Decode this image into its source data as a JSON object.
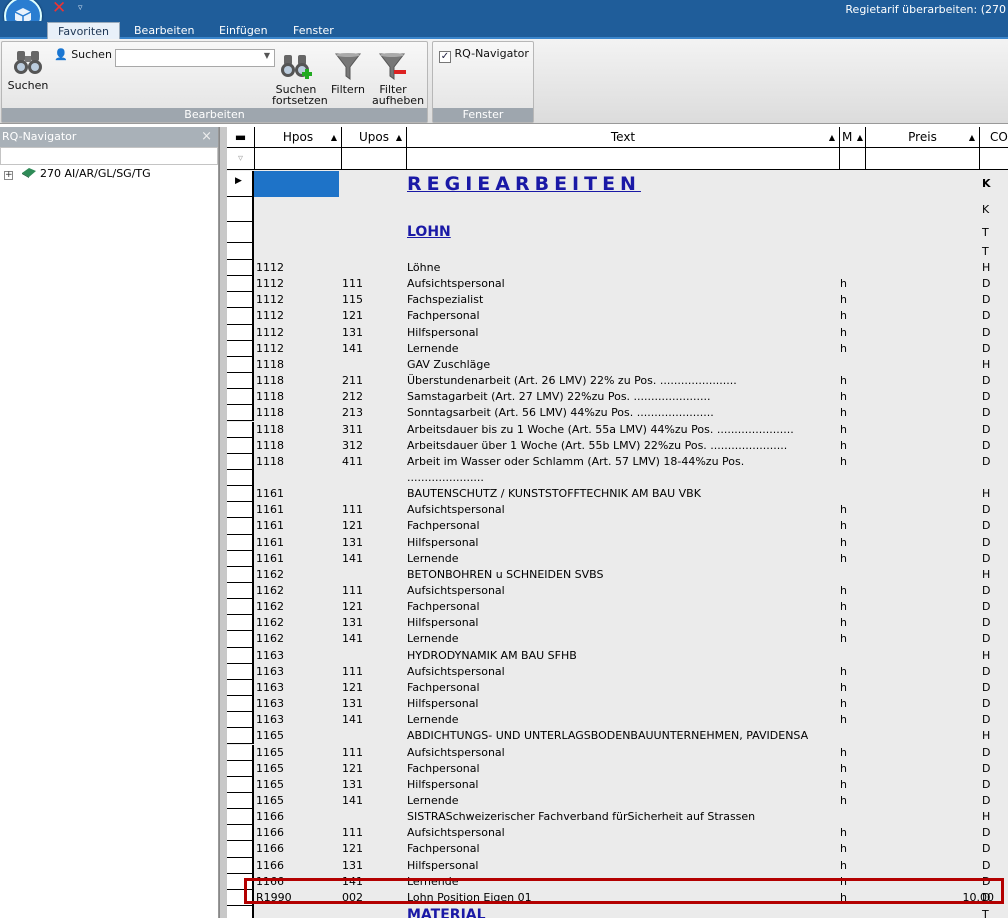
{
  "window": {
    "title": "Regietarif überarbeiten: (270"
  },
  "ribbon": {
    "tabs": [
      {
        "label": "Favoriten",
        "active": true
      },
      {
        "label": "Bearbeiten",
        "active": false
      },
      {
        "label": "Einfügen",
        "active": false
      },
      {
        "label": "Fenster",
        "active": false
      }
    ],
    "bearbeiten_group": {
      "label": "Bearbeiten",
      "suchen_small": "Suchen",
      "suchen": "Suchen",
      "suchen_fortsetzen_1": "Suchen",
      "suchen_fortsetzen_2": "fortsetzen",
      "filtern": "Filtern",
      "filter_aufheben_1": "Filter",
      "filter_aufheben_2": "aufheben"
    },
    "fenster_group": {
      "label": "Fenster",
      "rq_navigator": "RQ-Navigator",
      "rq_checked": "✓"
    }
  },
  "navigator": {
    "title": "RQ-Navigator",
    "close": "×",
    "tree": [
      {
        "expander": "+",
        "label": "270 AI/AR/GL/SG/TG"
      }
    ]
  },
  "grid": {
    "columns": {
      "hpos": "Hpos",
      "upos": "Upos",
      "text": "Text",
      "me": "M",
      "preis": "Preis",
      "co": "CO",
      "sort_up": "▲"
    },
    "filter_icon": "▿",
    "row_indicator": "▶",
    "rows": [
      {
        "hpos": "",
        "upos": "",
        "text": "REGIEARBEITEN",
        "me": "",
        "preis": "",
        "co": "K"
      },
      {
        "hpos": "",
        "upos": "",
        "text": "",
        "me": "",
        "preis": "",
        "co": "K"
      },
      {
        "hpos": "",
        "upos": "",
        "text": "LOHN",
        "me": "",
        "preis": "",
        "co": "T"
      },
      {
        "hpos": "",
        "upos": "",
        "text": "",
        "me": "",
        "preis": "",
        "co": "T"
      },
      {
        "hpos": "1112",
        "upos": "",
        "text": "Löhne",
        "me": "",
        "preis": "",
        "co": "H"
      },
      {
        "hpos": "1112",
        "upos": "111",
        "text": "Aufsichtspersonal",
        "me": "h",
        "preis": "",
        "co": "D"
      },
      {
        "hpos": "1112",
        "upos": "115",
        "text": "Fachspezialist",
        "me": "h",
        "preis": "",
        "co": "D"
      },
      {
        "hpos": "1112",
        "upos": "121",
        "text": "Fachpersonal",
        "me": "h",
        "preis": "",
        "co": "D"
      },
      {
        "hpos": "1112",
        "upos": "131",
        "text": "Hilfspersonal",
        "me": "h",
        "preis": "",
        "co": "D"
      },
      {
        "hpos": "1112",
        "upos": "141",
        "text": "Lernende",
        "me": "h",
        "preis": "",
        "co": "D"
      },
      {
        "hpos": "1118",
        "upos": "",
        "text": "GAV Zuschläge",
        "me": "",
        "preis": "",
        "co": "H"
      },
      {
        "hpos": "1118",
        "upos": "211",
        "text": "Überstundenarbeit (Art. 26 LMV)   22% zu Pos. ......................",
        "me": "h",
        "preis": "",
        "co": "D"
      },
      {
        "hpos": "1118",
        "upos": "212",
        "text": "Samstagarbeit (Art. 27 LMV)          22%zu Pos. ......................",
        "me": "h",
        "preis": "",
        "co": "D"
      },
      {
        "hpos": "1118",
        "upos": "213",
        "text": "Sonntagsarbeit (Art. 56 LMV)         44%zu Pos. ......................",
        "me": "h",
        "preis": "",
        "co": "D"
      },
      {
        "hpos": "1118",
        "upos": "311",
        "text": "Arbeitsdauer bis zu 1 Woche (Art. 55a LMV)   44%zu Pos. ......................",
        "me": "h",
        "preis": "",
        "co": "D"
      },
      {
        "hpos": "1118",
        "upos": "312",
        "text": "Arbeitsdauer über  1 Woche (Art. 55b LMV)  22%zu Pos. ......................",
        "me": "h",
        "preis": "",
        "co": "D"
      },
      {
        "hpos": "1118",
        "upos": "411",
        "text": "Arbeit im Wasser oder Schlamm (Art. 57 LMV)  18-44%zu Pos.",
        "me": "h",
        "preis": "",
        "co": "D"
      },
      {
        "hpos": "",
        "upos": "",
        "text": "......................",
        "me": "",
        "preis": "",
        "co": ""
      },
      {
        "hpos": "1161",
        "upos": "",
        "text": "BAUTENSCHUTZ / KUNSTSTOFFTECHNIK AM BAU VBK",
        "me": "",
        "preis": "",
        "co": "H"
      },
      {
        "hpos": "1161",
        "upos": "111",
        "text": "Aufsichtspersonal",
        "me": "h",
        "preis": "",
        "co": "D"
      },
      {
        "hpos": "1161",
        "upos": "121",
        "text": "Fachpersonal",
        "me": "h",
        "preis": "",
        "co": "D"
      },
      {
        "hpos": "1161",
        "upos": "131",
        "text": "Hilfspersonal",
        "me": "h",
        "preis": "",
        "co": "D"
      },
      {
        "hpos": "1161",
        "upos": "141",
        "text": "Lernende",
        "me": "h",
        "preis": "",
        "co": "D"
      },
      {
        "hpos": "1162",
        "upos": "",
        "text": "BETONBOHREN u SCHNEIDEN  SVBS",
        "me": "",
        "preis": "",
        "co": "H"
      },
      {
        "hpos": "1162",
        "upos": "111",
        "text": "Aufsichtspersonal",
        "me": "h",
        "preis": "",
        "co": "D"
      },
      {
        "hpos": "1162",
        "upos": "121",
        "text": "Fachpersonal",
        "me": "h",
        "preis": "",
        "co": "D"
      },
      {
        "hpos": "1162",
        "upos": "131",
        "text": "Hilfspersonal",
        "me": "h",
        "preis": "",
        "co": "D"
      },
      {
        "hpos": "1162",
        "upos": "141",
        "text": "Lernende",
        "me": "h",
        "preis": "",
        "co": "D"
      },
      {
        "hpos": "1163",
        "upos": "",
        "text": "HYDRODYNAMIK AM BAU  SFHB",
        "me": "",
        "preis": "",
        "co": "H"
      },
      {
        "hpos": "1163",
        "upos": "111",
        "text": "Aufsichtspersonal",
        "me": "h",
        "preis": "",
        "co": "D"
      },
      {
        "hpos": "1163",
        "upos": "121",
        "text": "Fachpersonal",
        "me": "h",
        "preis": "",
        "co": "D"
      },
      {
        "hpos": "1163",
        "upos": "131",
        "text": "Hilfspersonal",
        "me": "h",
        "preis": "",
        "co": "D"
      },
      {
        "hpos": "1163",
        "upos": "141",
        "text": "Lernende",
        "me": "h",
        "preis": "",
        "co": "D"
      },
      {
        "hpos": "1165",
        "upos": "",
        "text": "ABDICHTUNGS- UND UNTERLAGSBODENBAUUNTERNEHMEN, PAVIDENSA",
        "me": "",
        "preis": "",
        "co": "H"
      },
      {
        "hpos": "1165",
        "upos": "111",
        "text": "Aufsichtspersonal",
        "me": "h",
        "preis": "",
        "co": "D"
      },
      {
        "hpos": "1165",
        "upos": "121",
        "text": "Fachpersonal",
        "me": "h",
        "preis": "",
        "co": "D"
      },
      {
        "hpos": "1165",
        "upos": "131",
        "text": "Hilfspersonal",
        "me": "h",
        "preis": "",
        "co": "D"
      },
      {
        "hpos": "1165",
        "upos": "141",
        "text": "Lernende",
        "me": "h",
        "preis": "",
        "co": "D"
      },
      {
        "hpos": "1166",
        "upos": "",
        "text": "SISTRASchweizerischer Fachverband fürSicherheit auf Strassen",
        "me": "",
        "preis": "",
        "co": "H"
      },
      {
        "hpos": "1166",
        "upos": "111",
        "text": "Aufsichtspersonal",
        "me": "h",
        "preis": "",
        "co": "D"
      },
      {
        "hpos": "1166",
        "upos": "121",
        "text": "Fachpersonal",
        "me": "h",
        "preis": "",
        "co": "D"
      },
      {
        "hpos": "1166",
        "upos": "131",
        "text": "Hilfspersonal",
        "me": "h",
        "preis": "",
        "co": "D"
      },
      {
        "hpos": "1166",
        "upos": "141",
        "text": "Lernende",
        "me": "h",
        "preis": "",
        "co": "D"
      },
      {
        "hpos": "R1990",
        "upos": "002",
        "text": "Lohn Position Eigen 01",
        "me": "h",
        "preis": "10.00",
        "co": "D"
      },
      {
        "hpos": "",
        "upos": "",
        "text": "MATERIAL",
        "me": "",
        "preis": "",
        "co": "T"
      }
    ]
  }
}
